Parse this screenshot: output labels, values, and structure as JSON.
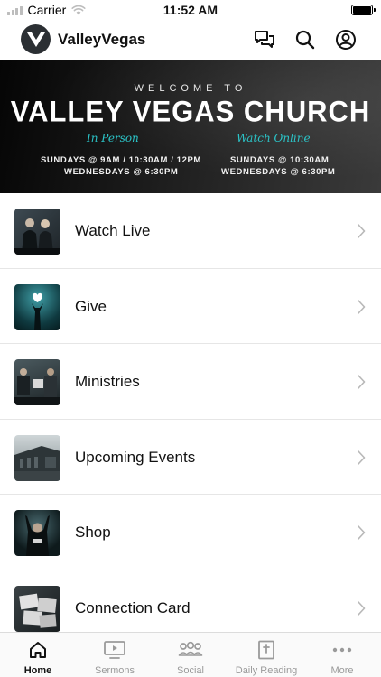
{
  "status_bar": {
    "carrier": "Carrier",
    "time": "11:52 AM"
  },
  "header": {
    "app_title": "ValleyVegas",
    "icons": [
      "chat-icon",
      "search-icon",
      "profile-icon"
    ]
  },
  "banner": {
    "welcome": "WELCOME TO",
    "church_name": "VALLEY VEGAS CHURCH",
    "in_person_label": "In Person",
    "watch_online_label": "Watch Online",
    "in_person_line1": "SUNDAYS @ 9AM / 10:30AM / 12PM",
    "in_person_line2": "WEDNESDAYS @ 6:30PM",
    "online_line1": "SUNDAYS @ 10:30AM",
    "online_line2": "WEDNESDAYS @ 6:30PM",
    "accent_color": "#2bc4c8"
  },
  "menu": {
    "items": [
      {
        "label": "Watch Live"
      },
      {
        "label": "Give"
      },
      {
        "label": "Ministries"
      },
      {
        "label": "Upcoming Events"
      },
      {
        "label": "Shop"
      },
      {
        "label": "Connection Card"
      }
    ]
  },
  "tab_bar": {
    "tabs": [
      {
        "label": "Home",
        "icon": "home-icon",
        "active": true
      },
      {
        "label": "Sermons",
        "icon": "tv-play-icon",
        "active": false
      },
      {
        "label": "Social",
        "icon": "group-icon",
        "active": false
      },
      {
        "label": "Daily Reading",
        "icon": "bible-icon",
        "active": false
      },
      {
        "label": "More",
        "icon": "more-dots-icon",
        "active": false
      }
    ]
  }
}
